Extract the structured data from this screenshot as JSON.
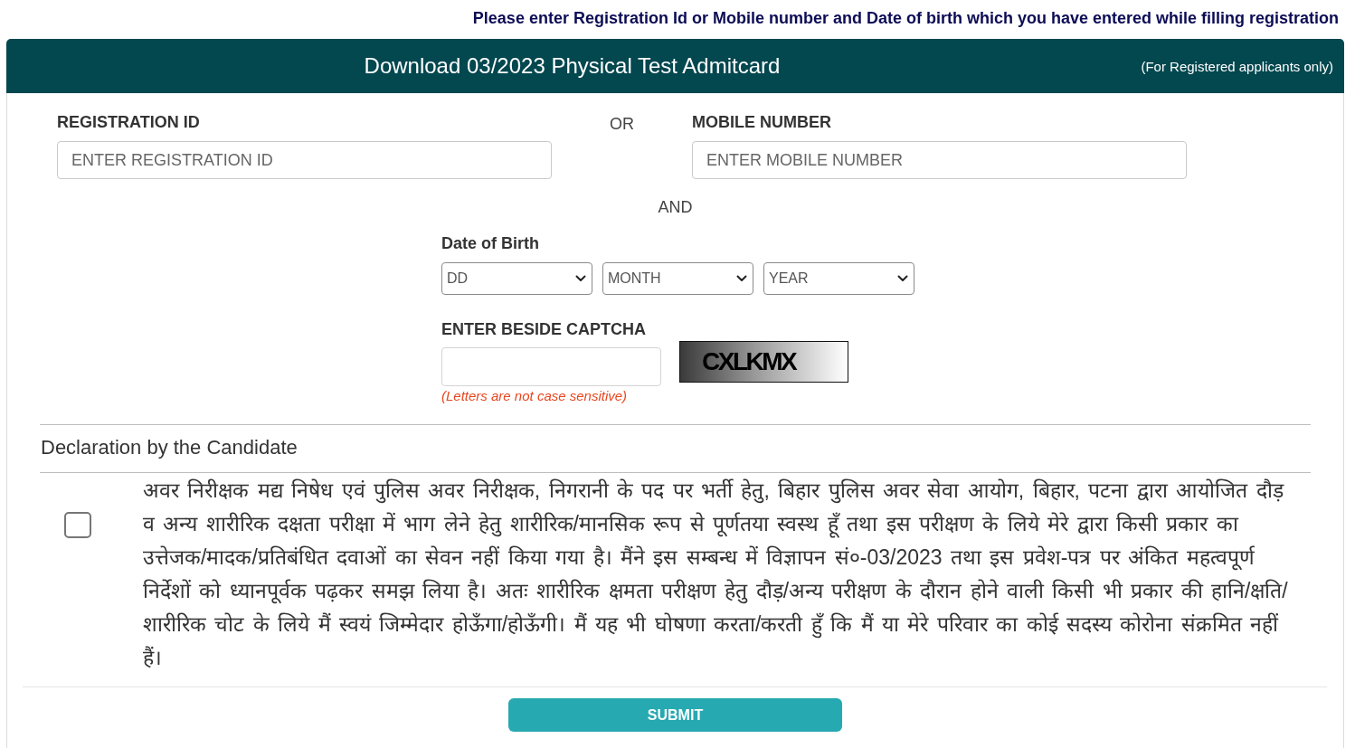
{
  "notice": "Please enter Registration Id or Mobile number and Date of birth which you have entered while filling registration",
  "panel": {
    "title": "Download 03/2023 Physical Test Admitcard",
    "note": "(For Registered applicants only)"
  },
  "form": {
    "registration": {
      "label": "REGISTRATION ID",
      "placeholder": "ENTER REGISTRATION ID"
    },
    "separator_or": "OR",
    "mobile": {
      "label": "MOBILE NUMBER",
      "placeholder": "ENTER MOBILE NUMBER"
    },
    "separator_and": "AND",
    "date_of_birth": {
      "label": "Date of Birth",
      "selects": [
        {
          "value": "DD"
        },
        {
          "value": "MONTH"
        },
        {
          "value": "YEAR"
        }
      ]
    },
    "captcha": {
      "label": "ENTER BESIDE CAPTCHA",
      "hint": "(Letters are not case sensitive)",
      "image_text": "CXLKMX"
    }
  },
  "declaration": {
    "title": "Declaration by the Candidate",
    "checked": false,
    "text": "अवर निरीक्षक मद्य निषेध एवं पुलिस अवर निरीक्षक, निगरानी के पद पर भर्ती हेतु, बिहार पुलिस अवर सेवा आयोग, बिहार, पटना द्वारा आयोजित दौड़ व अन्य शारीरिक दक्षता परीक्षा में भाग लेने हेतु शारीरिक/मानसिक रूप से पूर्णतया स्वस्थ हूँ तथा इस परीक्षण के लिये मेरे द्वारा किसी प्रकार का उत्तेजक/मादक/प्रतिबंधित दवाओं का सेवन नहीं किया गया है। मैंने इस सम्बन्ध में विज्ञापन सं०-03/2023 तथा इस प्रवेश-पत्र पर अंकित महत्वपूर्ण निर्देशों को ध्यानपूर्वक पढ़कर समझ लिया है। अतः शारीरिक क्षमता परीक्षण हेतु दौड़/अन्य परीक्षण के दौरान होने वाली किसी भी प्रकार की हानि/क्षति/शारीरिक चोट के लिये मैं स्वयं जिम्मेदार होऊँगा/होऊँगी। मैं यह भी घोषणा करता/करती हुँ कि मैं या मेरे परिवार का कोई सदस्य कोरोना संक्रमित नहीं हैं।"
  },
  "buttons": [
    {
      "label": "SUBMIT"
    }
  ]
}
